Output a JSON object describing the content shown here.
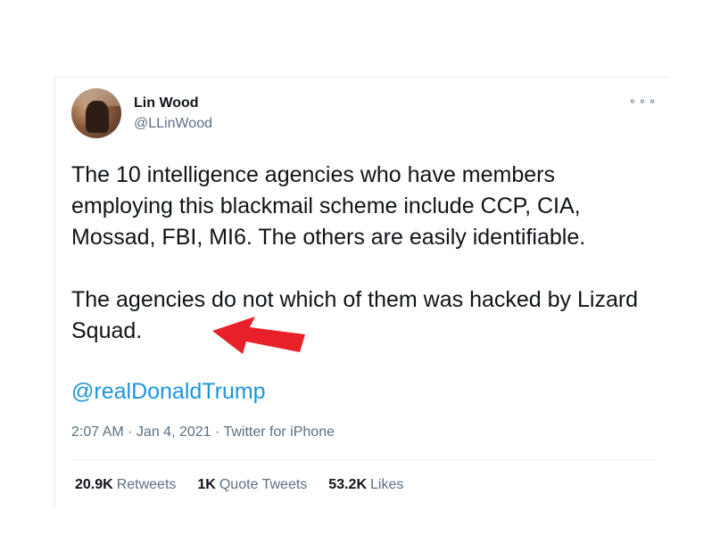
{
  "author": {
    "name": "Lin Wood",
    "handle": "@LLinWood"
  },
  "more_icon": "⚬⚬⚬",
  "tweet": {
    "paragraph_1": "The 10 intelligence agencies who have members employing this blackmail scheme include CCP, CIA, Mossad, FBI, MI6. The others are easily identifiable.",
    "paragraph_2": "The agencies do not which of them was hacked by Lizard Squad.",
    "mention": "@realDonaldTrump"
  },
  "meta": {
    "time": "2:07 AM",
    "separator": " · ",
    "date": "Jan 4, 2021",
    "source": "Twitter for iPhone"
  },
  "stats": {
    "retweets_count": "20.9K",
    "retweets_label": "Retweets",
    "quotes_count": "1K",
    "quotes_label": "Quote Tweets",
    "likes_count": "53.2K",
    "likes_label": "Likes"
  },
  "colors": {
    "link": "#1b95e0",
    "secondary_text": "#5b7083",
    "annotation_arrow": "#e8202a"
  },
  "icons": {
    "avatar": "profile-photo",
    "more": "more-options-icon",
    "annotation": "red-arrow-annotation"
  }
}
